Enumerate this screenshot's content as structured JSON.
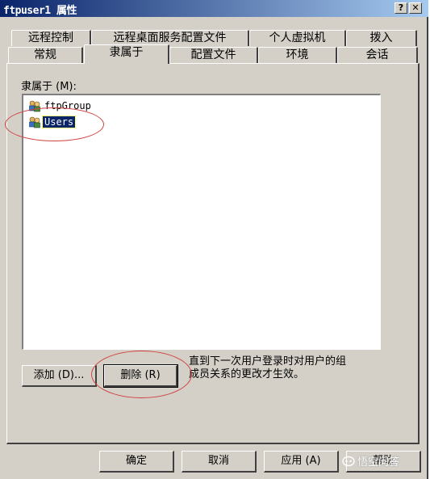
{
  "window": {
    "title": "ftpuser1 属性",
    "help_label": "?",
    "close_label": "✕"
  },
  "tabs": {
    "row_back": [
      "远程控制",
      "远程桌面服务配置文件",
      "个人虚拟机",
      "拨入"
    ],
    "row_front": [
      "常规",
      "隶属于",
      "配置文件",
      "环境",
      "会话"
    ],
    "active": "隶属于"
  },
  "member_of": {
    "label": "隶属于 (M):",
    "groups": [
      {
        "name": "ftpGroup",
        "icon": "group-icon",
        "selected": false
      },
      {
        "name": "Users",
        "icon": "group-icon",
        "selected": true
      }
    ]
  },
  "actions": {
    "add_label": "添加 (D)...",
    "remove_label": "删除 (R)",
    "note_line1": "直到下一次用户登录时对用户的组",
    "note_line2": "成员关系的更改才生效。"
  },
  "footer": {
    "ok_label": "确定",
    "cancel_label": "取消",
    "apply_label": "应用 (A)",
    "help_label": "帮助"
  },
  "watermark": {
    "text": "悟空问答",
    "icon": "wukong-logo-icon"
  },
  "colors": {
    "titlebar": "#0a246a",
    "face": "#d4d0c8",
    "selection": "#0a246a",
    "annotation": "#d04040"
  }
}
